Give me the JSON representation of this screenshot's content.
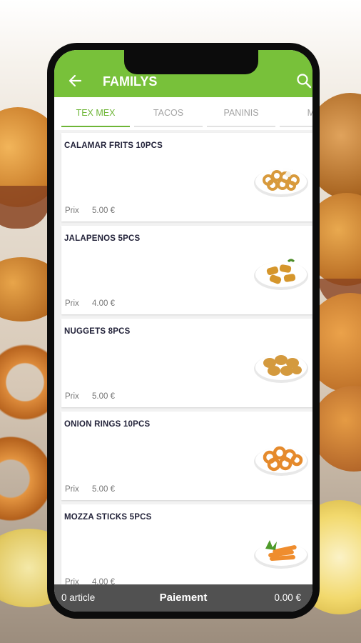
{
  "header": {
    "title": "FAMILYS"
  },
  "tabs": [
    {
      "label": "TEX MEX"
    },
    {
      "label": "TACOS"
    },
    {
      "label": "PANINIS"
    },
    {
      "label": "ME"
    }
  ],
  "price_label": "Prix",
  "products": [
    {
      "name": "CALAMAR FRITS 10PCS",
      "price": "5.00 €",
      "icon": "calamari-plate"
    },
    {
      "name": "JALAPENOS 5PCS",
      "price": "4.00 €",
      "icon": "jalapeno-plate"
    },
    {
      "name": "NUGGETS 8PCS",
      "price": "5.00 €",
      "icon": "nuggets-plate"
    },
    {
      "name": "ONION RINGS 10PCS",
      "price": "5.00 €",
      "icon": "onion-rings-plate"
    },
    {
      "name": "MOZZA STICKS 5PCS",
      "price": "4.00 €",
      "icon": "mozza-sticks-plate"
    }
  ],
  "cart": {
    "count_label": "0 article",
    "action_label": "Paiement",
    "total": "0.00 €"
  },
  "colors": {
    "accent": "#78c13a",
    "bottom_bar": "#515151"
  }
}
